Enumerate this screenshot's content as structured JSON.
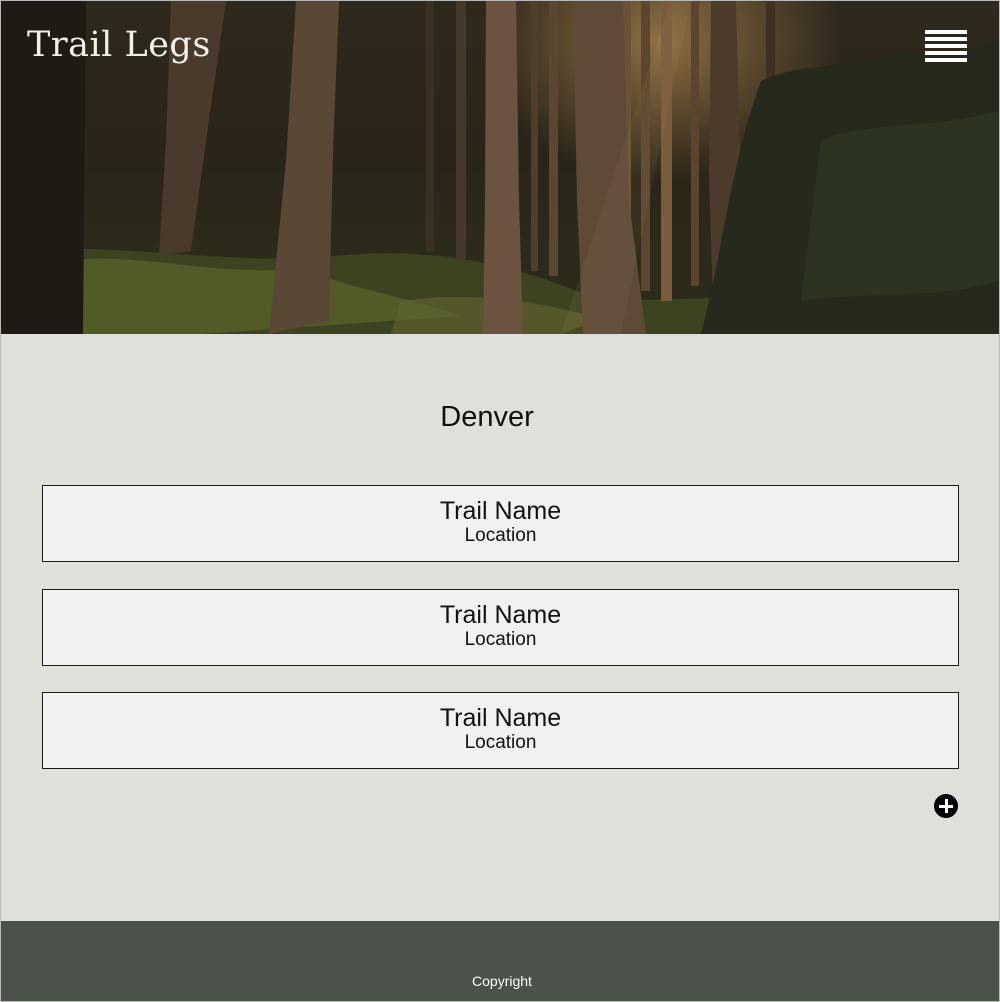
{
  "header": {
    "brand": "Trail Legs",
    "menu_icon": "hamburger-menu-icon"
  },
  "hero": {
    "image_description_icon": "forest-hero-image"
  },
  "main": {
    "city": "Denver",
    "trails": [
      {
        "name": "Trail Name",
        "location": "Location"
      },
      {
        "name": "Trail Name",
        "location": "Location"
      },
      {
        "name": "Trail Name",
        "location": "Location"
      }
    ],
    "add_icon": "plus-circle-icon"
  },
  "footer": {
    "copyright": "Copyright"
  },
  "colors": {
    "main_background": "#dfe0da",
    "card_background": "#f1f1f1",
    "footer_background": "#4a5249",
    "text": "#111111"
  }
}
